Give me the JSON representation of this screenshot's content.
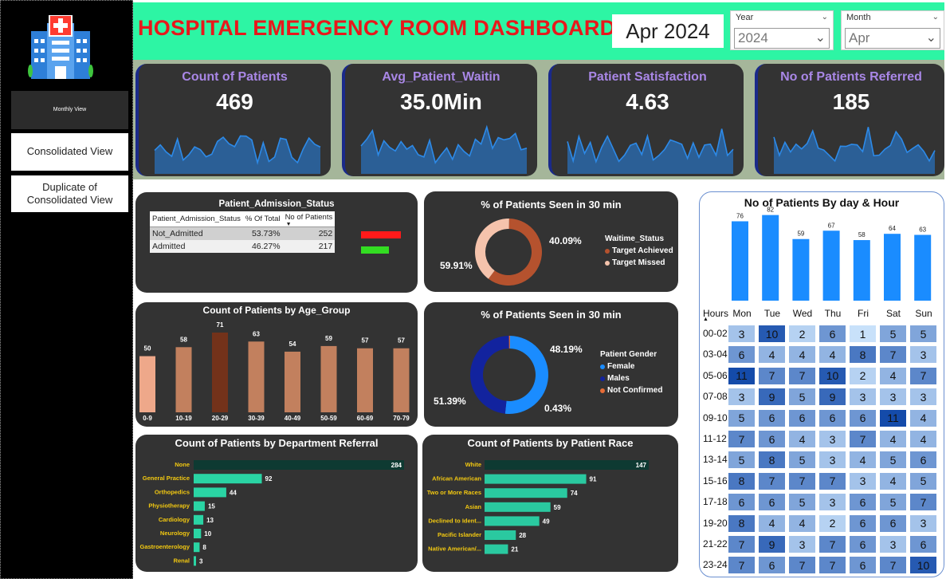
{
  "sidebar": {
    "monthly_view": "Monthly View",
    "consolidated_view": "Consolidated View",
    "duplicate_view": "Duplicate of Consolidated View"
  },
  "header": {
    "title": "HOSPITAL  EMERGENCY ROOM DASHBOARD",
    "date_display": "Apr 2024",
    "year_slicer": {
      "label": "Year",
      "value": "2024"
    },
    "month_slicer": {
      "label": "Month",
      "value": "Apr"
    }
  },
  "kpis": [
    {
      "title": "Count of Patients",
      "value": "469"
    },
    {
      "title": "Avg_Patient_Waitin",
      "value": "35.0Min"
    },
    {
      "title": "Patient Satisfaction",
      "value": "4.63"
    },
    {
      "title": "No of Patients Referred",
      "value": "185"
    }
  ],
  "admission": {
    "title": "Patient_Admission_Status",
    "columns": [
      "Patient_Admission_Status",
      "% Of Total",
      "No of Patients"
    ],
    "rows": [
      {
        "status": "Not_Admitted",
        "pct": "53.73%",
        "count": "252",
        "color": "#ff1a1a"
      },
      {
        "status": "Admitted",
        "pct": "46.27%",
        "count": "217",
        "color": "#33dd22"
      }
    ]
  },
  "colors": {
    "kpi_line": "#2d8ae8",
    "kpi_fill": "#2a6fb8",
    "age_bar": "#c2805e",
    "age_bar_light": "#eea88a",
    "age_bar_dark": "#73321a",
    "dept_bar": "#2ad4a4",
    "race_bar": "#2ac9a0",
    "heat_bar": "#1a8cff"
  },
  "chart_data": [
    {
      "type": "pie",
      "title": "% of Patients Seen in 30 min",
      "legend_title": "Waitime_Status",
      "categories": [
        "Target Achieved",
        "Target Missed"
      ],
      "values": [
        59.91,
        40.09
      ],
      "labels": [
        "59.91%",
        "40.09%"
      ],
      "colors": [
        "#b5522e",
        "#f5c3ac"
      ]
    },
    {
      "type": "bar",
      "title": "Count of Patients by Age_Group",
      "categories": [
        "0-9",
        "10-19",
        "20-29",
        "30-39",
        "40-49",
        "50-59",
        "60-69",
        "70-79"
      ],
      "values": [
        50,
        58,
        71,
        63,
        54,
        59,
        57,
        57
      ]
    },
    {
      "type": "pie",
      "title": "% of Patients Seen in 30 min",
      "legend_title": "Patient Gender",
      "categories": [
        "Female",
        "Males",
        "Not Confirmed"
      ],
      "values": [
        51.39,
        48.19,
        0.43
      ],
      "labels": [
        "51.39%",
        "48.19%",
        "0.43%"
      ],
      "colors": [
        "#1a8cff",
        "#12239e",
        "#e66c37"
      ]
    },
    {
      "type": "bar",
      "title": "Count of Patients by Department Referral",
      "categories": [
        "None",
        "General Practice",
        "Orthopedics",
        "Physiotherapy",
        "Cardiology",
        "Neurology",
        "Gastroenterology",
        "Renal"
      ],
      "values": [
        284,
        92,
        44,
        15,
        13,
        10,
        8,
        3
      ]
    },
    {
      "type": "bar",
      "title": "Count of Patients by Patient Race",
      "categories": [
        "White",
        "African American",
        "Two or More Races",
        "Asian",
        "Declined to Ident...",
        "Pacific Islander",
        "Native American/..."
      ],
      "values": [
        147,
        91,
        74,
        59,
        49,
        28,
        21
      ]
    },
    {
      "type": "bar",
      "title": "No of Patients By day & Hour",
      "categories": [
        "Mon",
        "Tue",
        "Wed",
        "Thu",
        "Fri",
        "Sat",
        "Sun"
      ],
      "values": [
        76,
        82,
        59,
        67,
        58,
        64,
        63
      ]
    },
    {
      "type": "heatmap",
      "row_header": "Hours",
      "columns": [
        "Mon",
        "Tue",
        "Wed",
        "Thu",
        "Fri",
        "Sat",
        "Sun"
      ],
      "rows": [
        "00-02",
        "03-04",
        "05-06",
        "07-08",
        "09-10",
        "11-12",
        "13-14",
        "15-16",
        "17-18",
        "19-20",
        "21-22",
        "23-24"
      ],
      "values": [
        [
          3,
          10,
          2,
          6,
          1,
          5,
          5
        ],
        [
          6,
          4,
          4,
          4,
          8,
          7,
          3
        ],
        [
          11,
          7,
          7,
          10,
          2,
          4,
          7
        ],
        [
          3,
          9,
          5,
          9,
          3,
          3,
          3
        ],
        [
          5,
          6,
          6,
          6,
          6,
          11,
          4
        ],
        [
          7,
          6,
          4,
          3,
          7,
          4,
          4
        ],
        [
          5,
          8,
          5,
          3,
          4,
          5,
          6
        ],
        [
          8,
          7,
          7,
          7,
          3,
          4,
          5
        ],
        [
          6,
          6,
          5,
          3,
          6,
          5,
          7
        ],
        [
          8,
          4,
          4,
          2,
          6,
          6,
          3
        ],
        [
          7,
          9,
          3,
          7,
          6,
          3,
          6
        ],
        [
          7,
          6,
          7,
          7,
          6,
          7,
          10
        ]
      ]
    }
  ]
}
